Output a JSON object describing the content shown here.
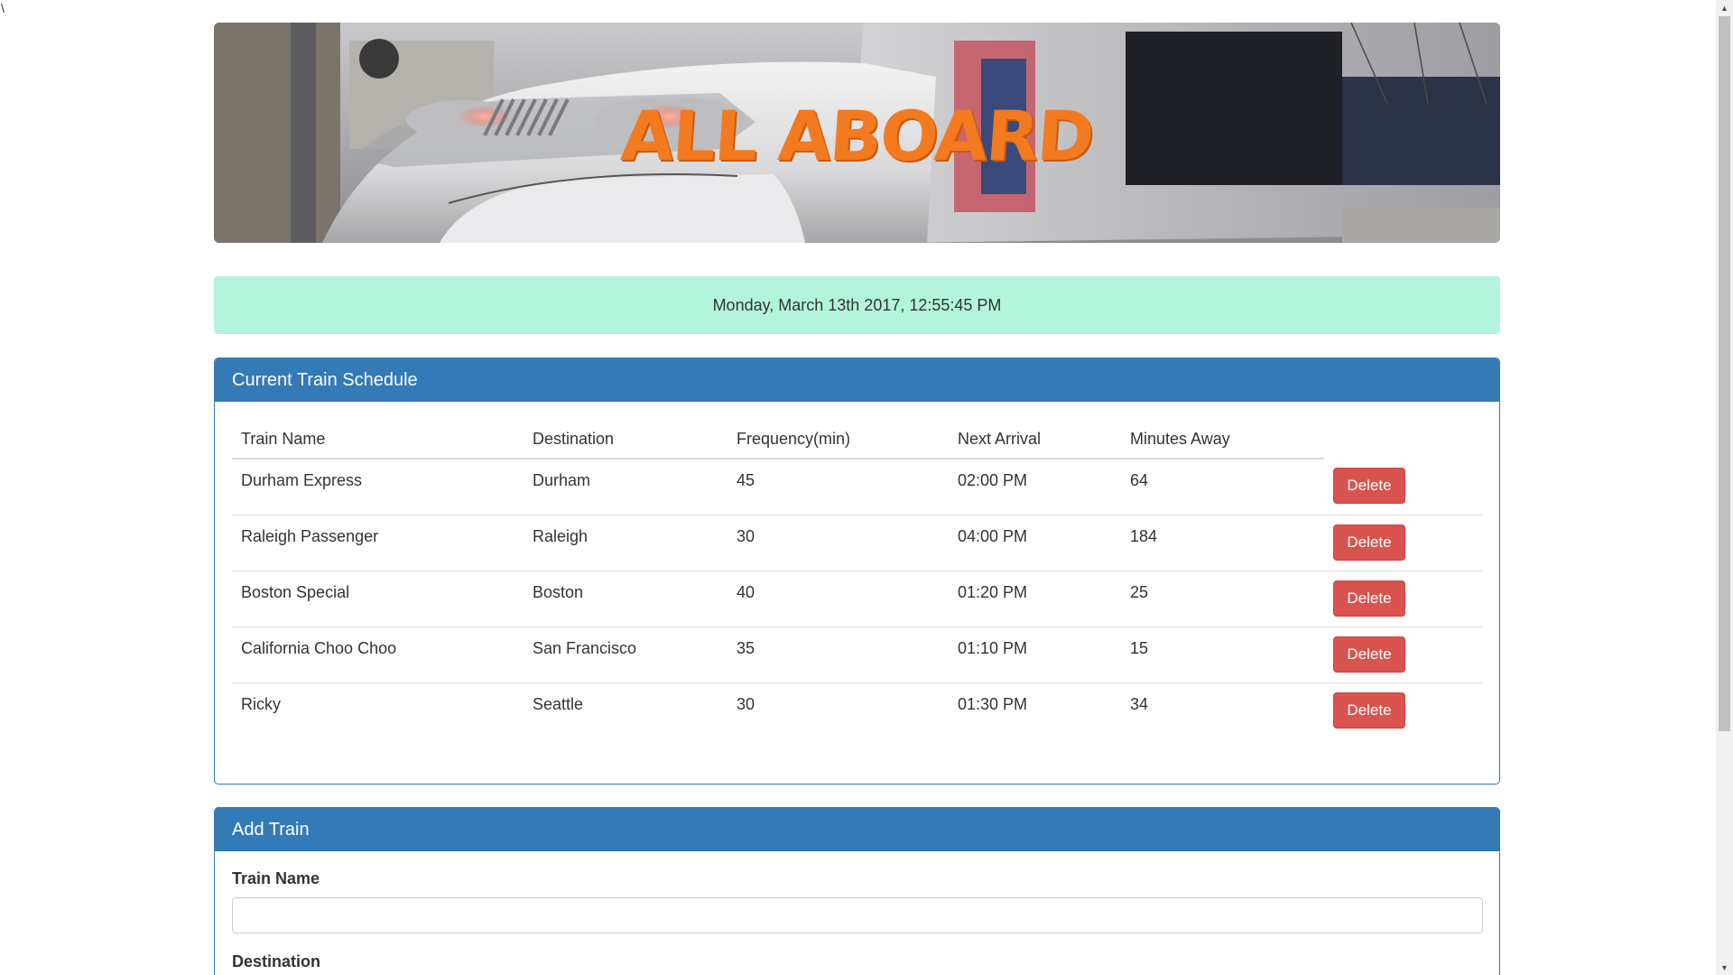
{
  "stray_text": "\\",
  "banner": {
    "title": "ALL ABOARD",
    "image_alt": "high-speed-train-photo"
  },
  "current_time": "Monday, March 13th 2017, 12:55:45 PM",
  "schedule": {
    "heading": "Current Train Schedule",
    "columns": [
      "Train Name",
      "Destination",
      "Frequency(min)",
      "Next Arrival",
      "Minutes Away"
    ],
    "rows": [
      {
        "name": "Durham Express",
        "destination": "Durham",
        "frequency": "45",
        "next_arrival": "02:00 PM",
        "minutes_away": "64",
        "action": "Delete"
      },
      {
        "name": "Raleigh Passenger",
        "destination": "Raleigh",
        "frequency": "30",
        "next_arrival": "04:00 PM",
        "minutes_away": "184",
        "action": "Delete"
      },
      {
        "name": "Boston Special",
        "destination": "Boston",
        "frequency": "40",
        "next_arrival": "01:20 PM",
        "minutes_away": "25",
        "action": "Delete"
      },
      {
        "name": "California Choo Choo",
        "destination": "San Francisco",
        "frequency": "35",
        "next_arrival": "01:10 PM",
        "minutes_away": "15",
        "action": "Delete"
      },
      {
        "name": "Ricky",
        "destination": "Seattle",
        "frequency": "30",
        "next_arrival": "01:30 PM",
        "minutes_away": "34",
        "action": "Delete"
      }
    ]
  },
  "add_train": {
    "heading": "Add Train",
    "train_name_label": "Train Name",
    "train_name_value": "",
    "destination_label": "Destination"
  },
  "colors": {
    "panel_primary": "#337ab7",
    "time_well": "#b3f5dc",
    "delete_button": "#d9534f",
    "title_orange": "#f47a20"
  },
  "icons": {
    "scroll_up": "chevron-up-icon",
    "scroll_down": "chevron-down-icon"
  }
}
